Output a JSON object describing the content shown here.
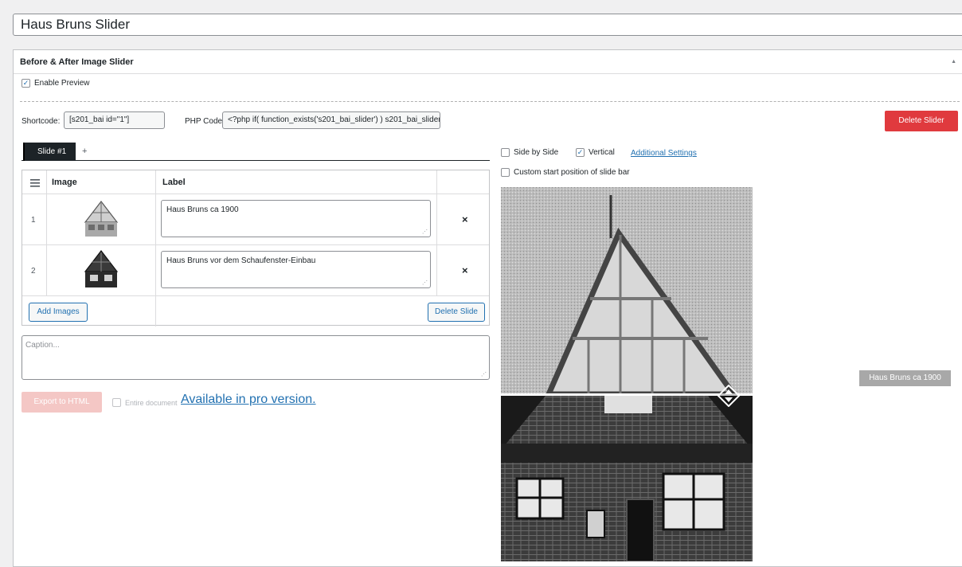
{
  "title": "Haus Bruns Slider",
  "panel": {
    "header": "Before & After Image Slider",
    "enable_preview_label": "Enable Preview",
    "enable_preview_checked": true
  },
  "shortcode": {
    "label": "Shortcode:",
    "value": "[s201_bai id=\"1\"]",
    "php_label": "PHP Code:",
    "php_value": "<?php if( function_exists('s201_bai_slider') ) s201_bai_slider"
  },
  "delete_slider_label": "Delete Slider",
  "tabs": [
    {
      "label": "Slide #1",
      "active": true
    }
  ],
  "tab_add_label": "+",
  "table": {
    "headers": {
      "image": "Image",
      "label": "Label"
    },
    "rows": [
      {
        "num": "1",
        "label": "Haus Bruns ca 1900"
      },
      {
        "num": "2",
        "label": "Haus Bruns vor dem Schaufenster-Einbau"
      }
    ],
    "remove_symbol": "×",
    "add_images_label": "Add Images",
    "delete_slide_label": "Delete Slide"
  },
  "caption_placeholder": "Caption...",
  "export_label": "Export to HTML",
  "entire_document_label": "Entire document",
  "pro_link": "Available in pro version.",
  "options": {
    "side_by_side": "Side by Side",
    "side_by_side_checked": false,
    "vertical": "Vertical",
    "vertical_checked": true,
    "additional_settings": "Additional Settings",
    "custom_start": "Custom start position of slide bar",
    "custom_start_checked": false
  },
  "preview_label": "Haus Bruns ca 1900",
  "icons": {
    "checkmark": "checkmark-icon",
    "menu": "hamburger-menu-icon",
    "collapse": "triangle-up-icon",
    "resize": "resize-handle-icon",
    "slider_handle": "up-down-arrows-icon"
  },
  "colors": {
    "primary": "#2271b1",
    "danger": "#e03a3e",
    "export_disabled": "#f4c7c5",
    "tab_dark": "#1d2327"
  }
}
